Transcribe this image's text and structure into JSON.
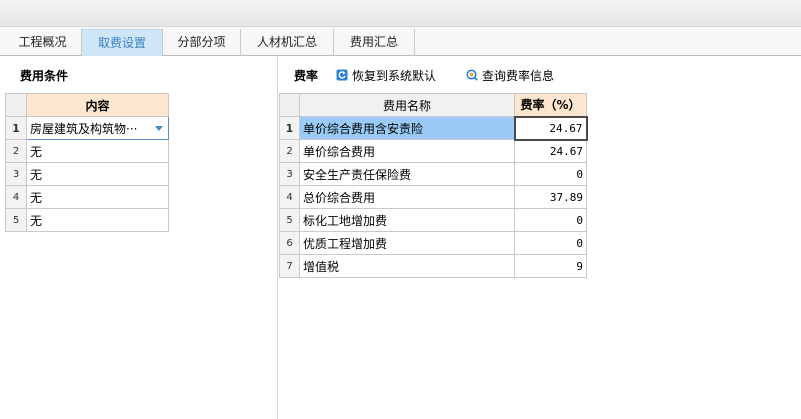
{
  "tabs": [
    "工程概况",
    "取费设置",
    "分部分项",
    "人材机汇总",
    "费用汇总"
  ],
  "left": {
    "title": "费用条件",
    "column_header": "内容",
    "rows": [
      {
        "index": "1",
        "value": "房屋建筑及构筑物···"
      },
      {
        "index": "2",
        "value": "无"
      },
      {
        "index": "3",
        "value": "无"
      },
      {
        "index": "4",
        "value": "无"
      },
      {
        "index": "5",
        "value": "无"
      }
    ]
  },
  "right": {
    "title": "费率",
    "restore_label": "恢复到系统默认",
    "query_label": "查询费率信息",
    "columns": [
      "费用名称",
      "费率（%）"
    ],
    "rows": [
      {
        "index": "1",
        "name": "单价综合费用含安责险",
        "rate": "24.67"
      },
      {
        "index": "2",
        "name": "单价综合费用",
        "rate": "24.67"
      },
      {
        "index": "3",
        "name": "安全生产责任保险费",
        "rate": "0"
      },
      {
        "index": "4",
        "name": "总价综合费用",
        "rate": "37.89"
      },
      {
        "index": "5",
        "name": "标化工地增加费",
        "rate": "0"
      },
      {
        "index": "6",
        "name": "优质工程增加费",
        "rate": "0"
      },
      {
        "index": "7",
        "name": "增值税",
        "rate": "9"
      }
    ]
  },
  "colors": {
    "active_tab_bg": "#cfe6f7",
    "selected_cell": "#99cbf6",
    "header_accent": "#fde6cf"
  }
}
